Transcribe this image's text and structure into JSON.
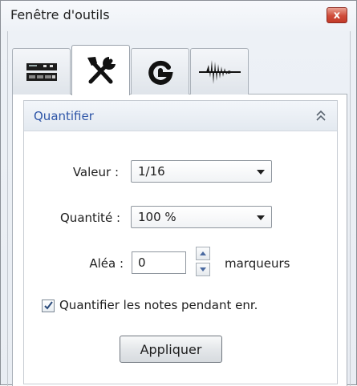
{
  "window": {
    "title": "Fenêtre d'outils",
    "close_glyph": "x"
  },
  "tabs": [
    {
      "icon": "mixer-icon",
      "active": false
    },
    {
      "icon": "tools-icon",
      "active": true
    },
    {
      "icon": "groove-icon",
      "active": false
    },
    {
      "icon": "waveform-icon",
      "active": false
    }
  ],
  "panel": {
    "title": "Quantifier",
    "collapse_icon": "double-chevron-up-icon",
    "valeur": {
      "label": "Valeur :",
      "value": "1/16"
    },
    "quantite": {
      "label": "Quantité :",
      "value": "100 %"
    },
    "alea": {
      "label": "Aléa :",
      "value": "0",
      "unit": "marqueurs"
    },
    "quantize_during_record": {
      "label": "Quantifier les notes pendant enr.",
      "checked": true
    },
    "apply_label": "Appliquer"
  },
  "colors": {
    "accent_title": "#2f56a8",
    "close_button": "#cf4c3a"
  }
}
